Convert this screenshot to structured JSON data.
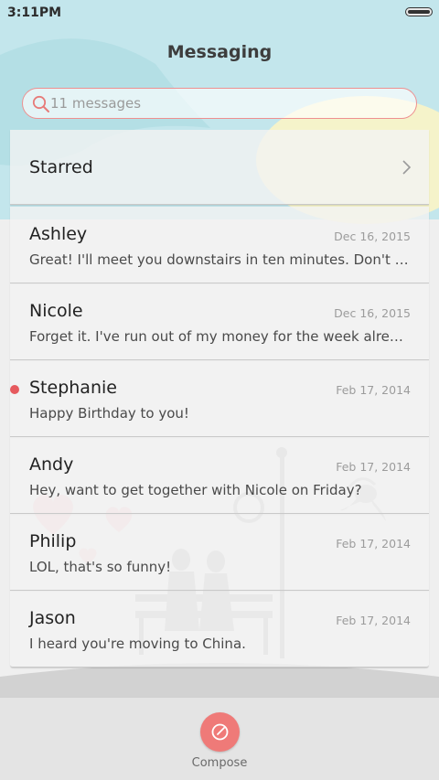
{
  "status_bar": {
    "time": "3:11PM",
    "battery_level": 1.0
  },
  "header": {
    "title": "Messaging"
  },
  "search": {
    "placeholder": "11 messages"
  },
  "starred": {
    "label": "Starred"
  },
  "conversations": [
    {
      "contact": "Ashley",
      "date": "Dec 16, 2015",
      "preview": "Great! I'll meet you downstairs in ten minutes. Don't forget to bring your umbrella.",
      "unread": false
    },
    {
      "contact": "Nicole",
      "date": "Dec 16, 2015",
      "preview": "Forget it. I've run out of my money for the week already.",
      "unread": false
    },
    {
      "contact": "Stephanie",
      "date": "Feb 17, 2014",
      "preview": "Happy Birthday to you!",
      "unread": true
    },
    {
      "contact": "Andy",
      "date": "Feb 17, 2014",
      "preview": "Hey, want to get together with Nicole on Friday?",
      "unread": false
    },
    {
      "contact": "Philip",
      "date": "Feb 17, 2014",
      "preview": "LOL, that's so funny!",
      "unread": false
    },
    {
      "contact": "Jason",
      "date": "Feb 17, 2014",
      "preview": "I heard you're moving to China.",
      "unread": false
    }
  ],
  "compose": {
    "label": "Compose"
  },
  "colors": {
    "accent": "#ef7a78",
    "unread_dot": "#e65a5e",
    "sky": "#bfe4ea",
    "sun": "#fff4b8"
  },
  "icons": {
    "search": "search-icon",
    "chevron": "chevron-right-icon",
    "compose": "compose-icon"
  }
}
